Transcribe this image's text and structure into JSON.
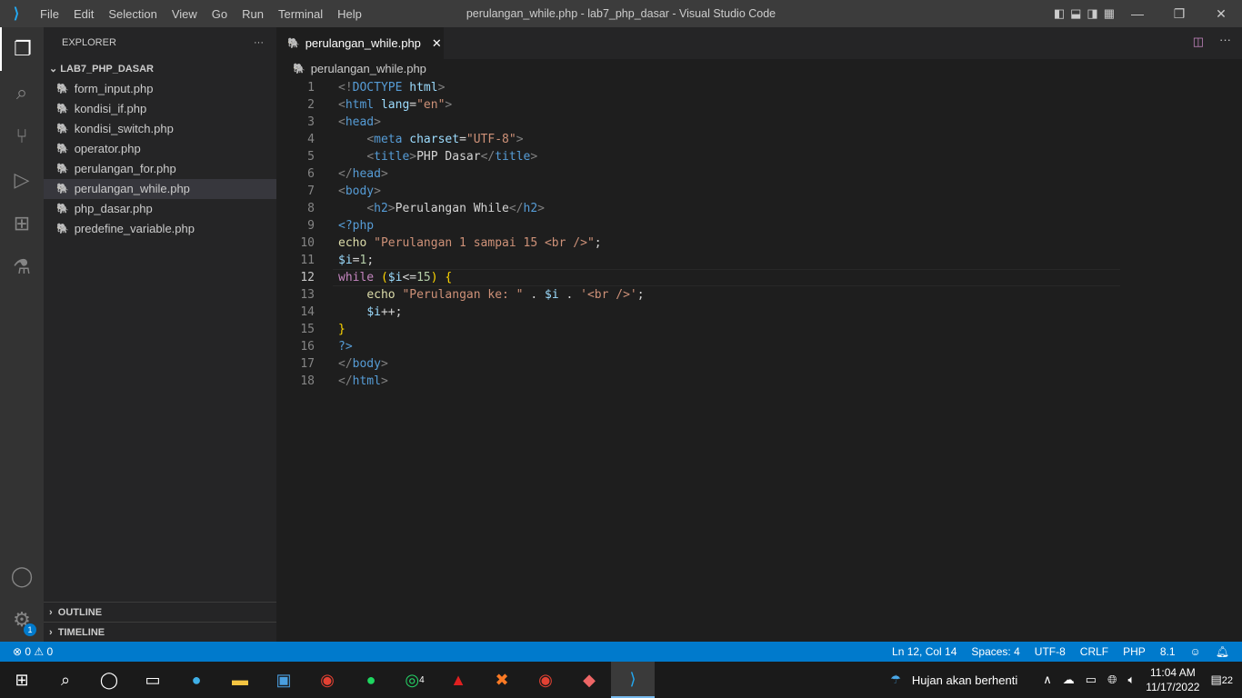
{
  "window": {
    "title": "perulangan_while.php - lab7_php_dasar - Visual Studio Code",
    "menu": [
      "File",
      "Edit",
      "Selection",
      "View",
      "Go",
      "Run",
      "Terminal",
      "Help"
    ]
  },
  "sidebar": {
    "title": "EXPLORER",
    "more": "···",
    "folder": "LAB7_PHP_DASAR",
    "files": [
      "form_input.php",
      "kondisi_if.php",
      "kondisi_switch.php",
      "operator.php",
      "perulangan_for.php",
      "perulangan_while.php",
      "php_dasar.php",
      "predefine_variable.php"
    ],
    "selected": "perulangan_while.php",
    "outline": "OUTLINE",
    "timeline": "TIMELINE"
  },
  "activity": {
    "settings_badge": "1"
  },
  "editor": {
    "tab": "perulangan_while.php",
    "breadcrumb": "perulangan_while.php",
    "current_line": 12,
    "lines": [
      [
        [
          "b",
          "<!"
        ],
        [
          "t",
          "DOCTYPE"
        ],
        [
          "x",
          " "
        ],
        [
          "a",
          "html"
        ],
        [
          "b",
          ">"
        ]
      ],
      [
        [
          "b",
          "<"
        ],
        [
          "t",
          "html"
        ],
        [
          "x",
          " "
        ],
        [
          "a",
          "lang"
        ],
        [
          "x",
          "="
        ],
        [
          "s",
          "\"en\""
        ],
        [
          "b",
          ">"
        ]
      ],
      [
        [
          "b",
          "<"
        ],
        [
          "t",
          "head"
        ],
        [
          "b",
          ">"
        ]
      ],
      [
        [
          "x",
          "    "
        ],
        [
          "b",
          "<"
        ],
        [
          "t",
          "meta"
        ],
        [
          "x",
          " "
        ],
        [
          "a",
          "charset"
        ],
        [
          "x",
          "="
        ],
        [
          "s",
          "\"UTF-8\""
        ],
        [
          "b",
          ">"
        ]
      ],
      [
        [
          "x",
          "    "
        ],
        [
          "b",
          "<"
        ],
        [
          "t",
          "title"
        ],
        [
          "b",
          ">"
        ],
        [
          "x",
          "PHP Dasar"
        ],
        [
          "b",
          "</"
        ],
        [
          "t",
          "title"
        ],
        [
          "b",
          ">"
        ]
      ],
      [
        [
          "b",
          "</"
        ],
        [
          "t",
          "head"
        ],
        [
          "b",
          ">"
        ]
      ],
      [
        [
          "b",
          "<"
        ],
        [
          "t",
          "body"
        ],
        [
          "b",
          ">"
        ]
      ],
      [
        [
          "x",
          "    "
        ],
        [
          "b",
          "<"
        ],
        [
          "t",
          "h2"
        ],
        [
          "b",
          ">"
        ],
        [
          "x",
          "Perulangan While"
        ],
        [
          "b",
          "</"
        ],
        [
          "t",
          "h2"
        ],
        [
          "b",
          ">"
        ]
      ],
      [
        [
          "t",
          "<?php"
        ]
      ],
      [
        [
          "f",
          "echo"
        ],
        [
          "x",
          " "
        ],
        [
          "s",
          "\"Perulangan 1 sampai 15 <br />\""
        ],
        [
          "x",
          ";"
        ]
      ],
      [
        [
          "v",
          "$i"
        ],
        [
          "x",
          "="
        ],
        [
          "n",
          "1"
        ],
        [
          "x",
          ";"
        ]
      ],
      [
        [
          "k",
          "while"
        ],
        [
          "x",
          " "
        ],
        [
          "y",
          "("
        ],
        [
          "v",
          "$i"
        ],
        [
          "x",
          "<="
        ],
        [
          "n",
          "15"
        ],
        [
          "y",
          ")"
        ],
        [
          "x",
          " "
        ],
        [
          "y",
          "{"
        ]
      ],
      [
        [
          "x",
          "    "
        ],
        [
          "f",
          "echo"
        ],
        [
          "x",
          " "
        ],
        [
          "s",
          "\"Perulangan ke: \""
        ],
        [
          "x",
          " . "
        ],
        [
          "v",
          "$i"
        ],
        [
          "x",
          " . "
        ],
        [
          "s",
          "'<br />'"
        ],
        [
          "x",
          ";"
        ]
      ],
      [
        [
          "x",
          "    "
        ],
        [
          "v",
          "$i"
        ],
        [
          "x",
          "++;"
        ]
      ],
      [
        [
          "y",
          "}"
        ]
      ],
      [
        [
          "t",
          "?>"
        ]
      ],
      [
        [
          "b",
          "</"
        ],
        [
          "t",
          "body"
        ],
        [
          "b",
          ">"
        ]
      ],
      [
        [
          "b",
          "</"
        ],
        [
          "t",
          "html"
        ],
        [
          "b",
          ">"
        ]
      ]
    ]
  },
  "status": {
    "errors": "0",
    "warnings": "0",
    "position": "Ln 12, Col 14",
    "spaces": "Spaces: 4",
    "encoding": "UTF-8",
    "eol": "CRLF",
    "language": "PHP",
    "version": "8.1"
  },
  "taskbar": {
    "weather": "Hujan akan berhenti",
    "time": "11:04 AM",
    "date": "11/17/2022",
    "notifications": "22",
    "whatsapp_badge": "4"
  }
}
